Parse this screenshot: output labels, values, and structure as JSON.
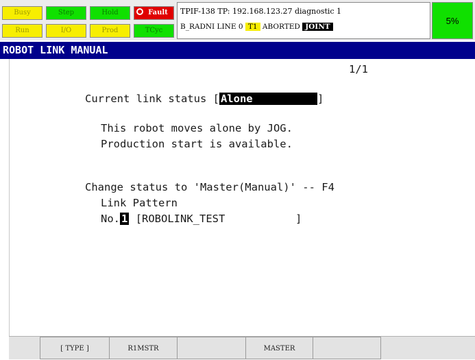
{
  "status_indicators": {
    "busy": "Busy",
    "step": "Step",
    "hold": "Hold",
    "fault": "Fault",
    "run": "Run",
    "io": "I/O",
    "prod": "Prod",
    "tcyc": "TCyc"
  },
  "header": {
    "line1": "TPIF-138 TP: 192.168.123.27 diagnostic 1",
    "program": "B_RADNI LINE 0",
    "tool": "T1",
    "state": "ABORTED",
    "coord": "JOINT",
    "override": "5%"
  },
  "screen": {
    "title": "ROBOT LINK MANUAL",
    "page": "1/1",
    "current_label": "Current link status [",
    "current_value": "Alone",
    "current_close": "]",
    "info1": "This robot moves alone by JOG.",
    "info2": "Production start is available.",
    "change": "Change status to 'Master(Manual)' -- F4",
    "pattern_label": "Link Pattern",
    "no_label": "No.",
    "no_value": "1",
    "pattern_name": "[ROBOLINK_TEST           ]"
  },
  "fkeys": [
    "[ TYPE ]",
    "R1MSTR",
    "",
    "MASTER",
    ""
  ],
  "colors": {
    "title_bar": "#00008c",
    "override": "#10e000",
    "fault": "#e00000",
    "indicator": "#f7ee00"
  }
}
